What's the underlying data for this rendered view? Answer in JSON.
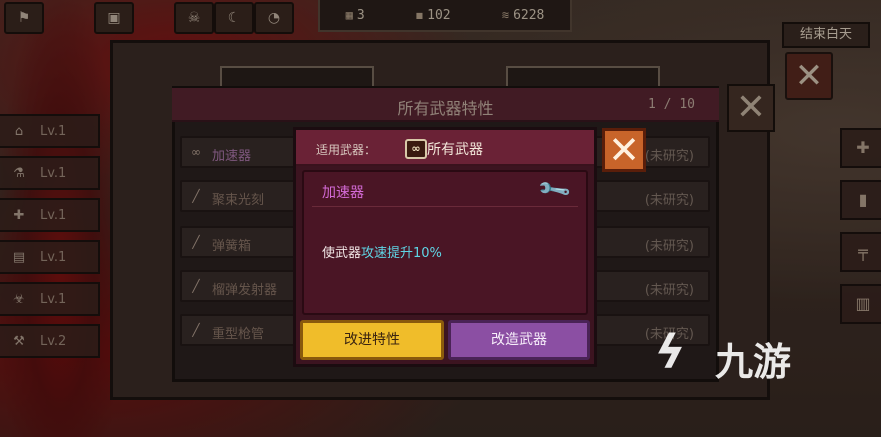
{
  "top": {
    "days": "3",
    "food": "102",
    "resource": "6228",
    "end_day_label": "结束白天"
  },
  "sidebar": {
    "items": [
      {
        "icon": "home-icon",
        "level": "Lv.1"
      },
      {
        "icon": "lab-icon",
        "level": "Lv.1"
      },
      {
        "icon": "medkit-icon",
        "level": "Lv.1"
      },
      {
        "icon": "radio-icon",
        "level": "Lv.1"
      },
      {
        "icon": "biohazard-icon",
        "level": "Lv.1"
      },
      {
        "icon": "hammer-icon",
        "level": "Lv.2"
      }
    ]
  },
  "panel": {
    "title": "所有武器特性",
    "page": "1 / 10",
    "rows": [
      {
        "name": "加速器",
        "status": "(未研究)"
      },
      {
        "name": "聚束光刻",
        "status": "(未研究)"
      },
      {
        "name": "弹簧箱",
        "status": "(未研究)"
      },
      {
        "name": "榴弹发射器",
        "status": "(未研究)"
      },
      {
        "name": "重型枪管",
        "status": "(未研究)"
      }
    ]
  },
  "dialog": {
    "applies_label": "适用武器：",
    "applies_icon": "∞",
    "applies_value": "所有武器",
    "trait_name": "加速器",
    "desc_prefix": "使武器",
    "desc_highlight": "攻速提升10%",
    "improve_label": "改进特性",
    "modify_label": "改造武器"
  },
  "watermark": "九游",
  "colors": {
    "highlight": "#5fd6e6",
    "trait_name": "#d46ad6",
    "improve_button": "#f0bd2a",
    "modify_button": "#8b4fa3",
    "close_button": "#c8642a"
  }
}
